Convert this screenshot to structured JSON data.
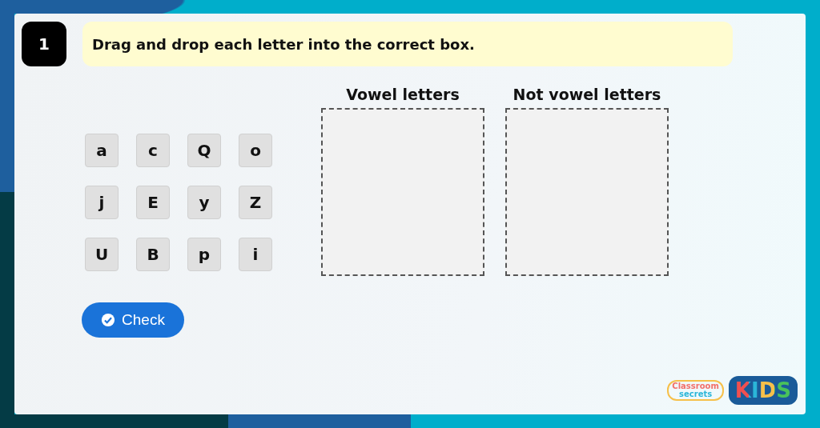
{
  "question": {
    "number": "1",
    "instruction": "Drag and drop each letter into the correct box."
  },
  "letters": [
    "a",
    "c",
    "Q",
    "o",
    "j",
    "E",
    "y",
    "Z",
    "U",
    "B",
    "p",
    "i"
  ],
  "drop_zones": [
    {
      "label": "Vowel letters"
    },
    {
      "label": "Not vowel letters"
    }
  ],
  "check_button": {
    "label": "Check"
  },
  "logo": {
    "brand": "Classroom",
    "brand_sub": "secrets",
    "badge": "KIDS"
  }
}
